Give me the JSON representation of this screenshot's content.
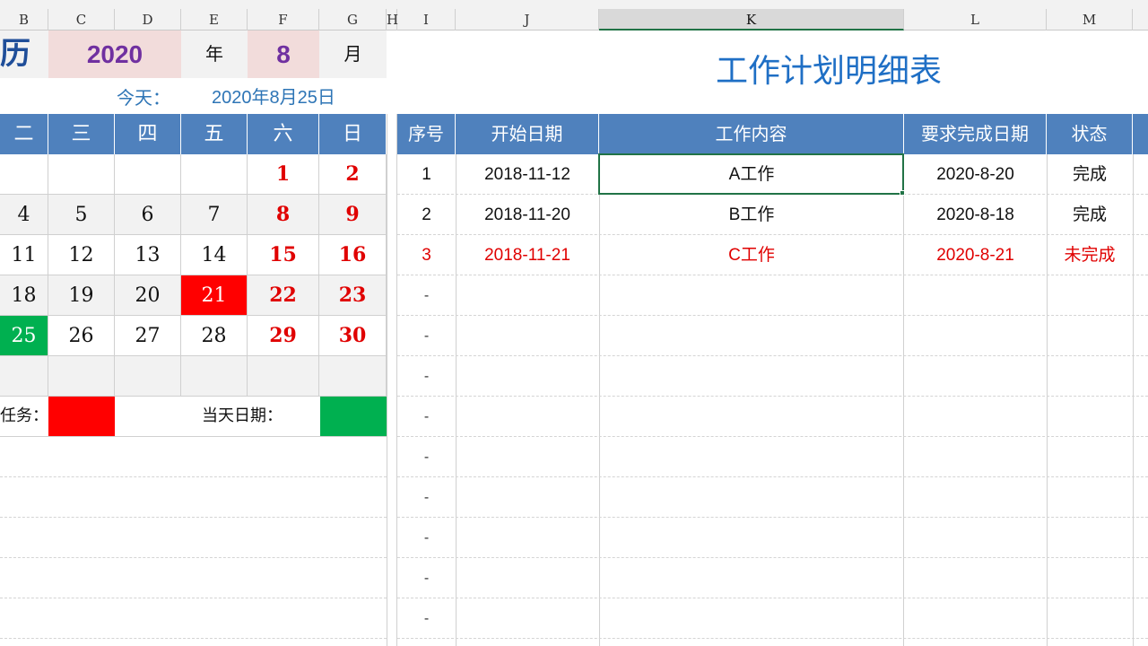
{
  "columns": [
    "B",
    "C",
    "D",
    "E",
    "F",
    "G",
    "H",
    "I",
    "J",
    "K",
    "L",
    "M"
  ],
  "selected_column": "K",
  "calendar": {
    "title_fragment": "历",
    "year": "2020",
    "year_unit": "年",
    "month": "8",
    "month_unit": "月",
    "today_label": "今天：",
    "today_value": "2020年8月25日",
    "weekdays": [
      "二",
      "三",
      "四",
      "五",
      "六",
      "日"
    ],
    "weeks": [
      [
        "",
        "",
        "",
        "",
        "1",
        "2"
      ],
      [
        "4",
        "5",
        "6",
        "7",
        "8",
        "9"
      ],
      [
        "11",
        "12",
        "13",
        "14",
        "15",
        "16"
      ],
      [
        "18",
        "19",
        "20",
        "21",
        "22",
        "23"
      ],
      [
        "25",
        "26",
        "27",
        "28",
        "29",
        "30"
      ],
      [
        "",
        "",
        "",
        "",
        "",
        ""
      ]
    ],
    "task_legend_label": "任务：",
    "today_legend_label": "当天日期：",
    "task_color": "#ff0000",
    "today_color": "#00b050"
  },
  "plan": {
    "title": "工作计划明细表",
    "headers": [
      "序号",
      "开始日期",
      "工作内容",
      "要求完成日期",
      "状态"
    ],
    "rows": [
      {
        "no": "1",
        "start": "2018-11-12",
        "content": "A工作",
        "due": "2020-8-20",
        "status": "完成"
      },
      {
        "no": "2",
        "start": "2018-11-20",
        "content": "B工作",
        "due": "2020-8-18",
        "status": "完成"
      },
      {
        "no": "3",
        "start": "2018-11-21",
        "content": "C工作",
        "due": "2020-8-21",
        "status": "未完成"
      }
    ],
    "empty_marker": "-",
    "header_color": "#4f81bd",
    "overdue_color": "#e00000"
  }
}
